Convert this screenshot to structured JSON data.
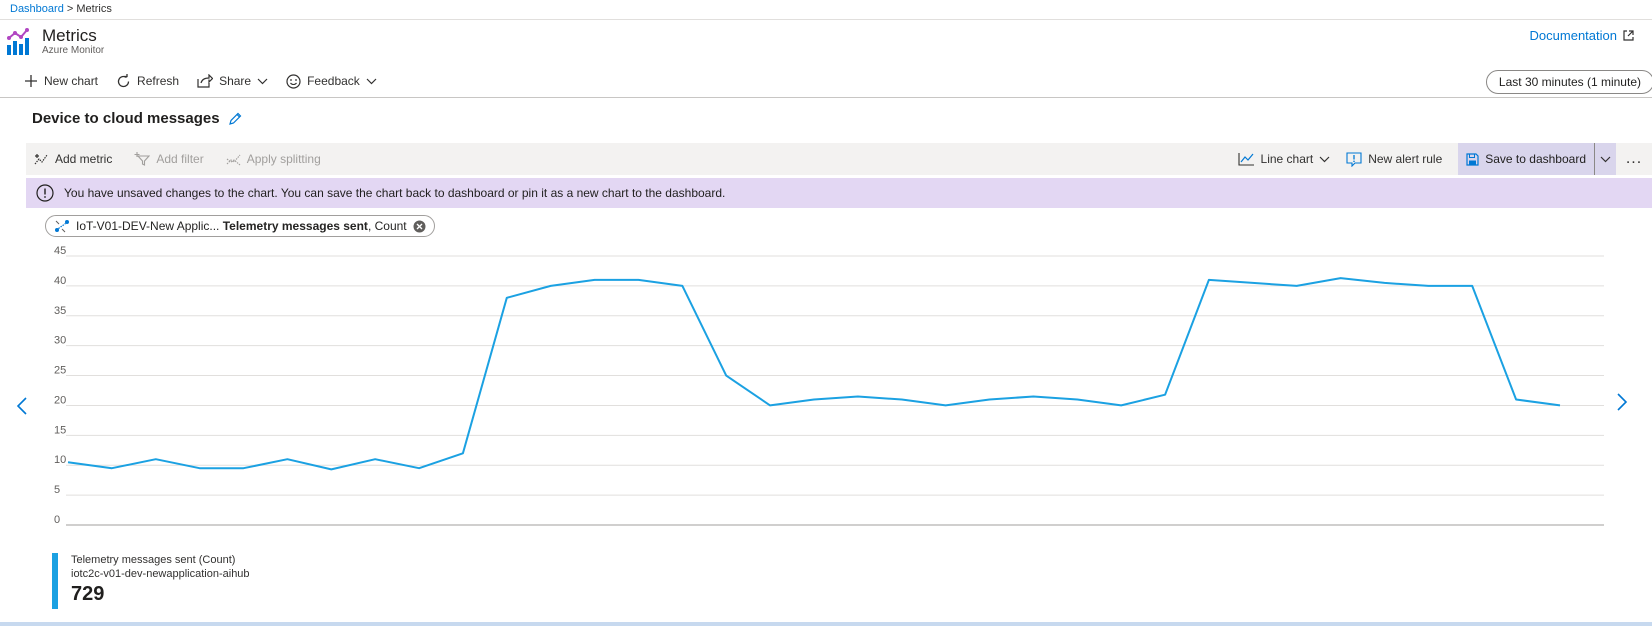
{
  "breadcrumb": {
    "parent": "Dashboard",
    "separator": " > ",
    "current": "Metrics"
  },
  "header": {
    "title": "Metrics",
    "subtitle": "Azure Monitor",
    "documentation_label": "Documentation"
  },
  "toolbar": {
    "new_chart": "New chart",
    "refresh": "Refresh",
    "share": "Share",
    "feedback": "Feedback",
    "time_range": "Last 30 minutes (1 minute)"
  },
  "chart_card": {
    "title": "Device to cloud messages",
    "add_metric": "Add metric",
    "add_filter": "Add filter",
    "apply_splitting": "Apply splitting",
    "chart_type": "Line chart",
    "new_alert_rule": "New alert rule",
    "save_to_dashboard": "Save to dashboard",
    "more": "..."
  },
  "banner": {
    "message": "You have unsaved changes to the chart. You can save the chart back to dashboard or pin it as a new chart to the dashboard."
  },
  "metric_pill": {
    "resource": "IoT-V01-DEV-New Applic...",
    "metric": "Telemetry messages sent",
    "aggregation": ", Count"
  },
  "legend": {
    "name": "Telemetry messages sent (Count)",
    "resource": "iotc2c-v01-dev-newapplication-aihub",
    "total": "729"
  },
  "colors": {
    "accent": "#0078d4",
    "series": "#1ba1e2",
    "banner": "#e3d7f3",
    "save_highlight": "#d9d5ec"
  },
  "chart_data": {
    "type": "line",
    "y_ticks": [
      0,
      5,
      10,
      15,
      20,
      25,
      30,
      35,
      40,
      45
    ],
    "ylim": [
      0,
      45
    ],
    "grid": true,
    "series": [
      {
        "values": [
          10.5,
          9.5,
          11,
          9.5,
          9.5,
          11,
          9.3,
          11,
          9.5,
          12,
          38,
          40,
          41,
          41,
          40,
          25,
          20,
          21,
          21.5,
          21,
          20,
          21,
          21.5,
          21,
          20,
          21.8,
          41,
          40.5,
          40,
          41.3,
          40.5,
          40,
          40,
          21,
          20
        ]
      }
    ]
  }
}
